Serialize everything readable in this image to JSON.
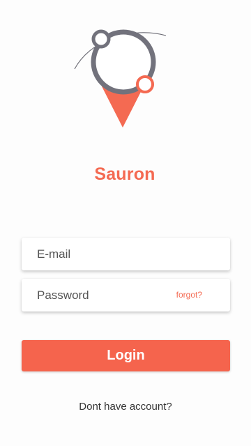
{
  "app": {
    "title": "Sauron",
    "logo": "location-pin-ring-logo"
  },
  "colors": {
    "accent": "#f46a52",
    "button": "#f5644d",
    "ring": "#72727c",
    "text": "#333333"
  },
  "form": {
    "email_placeholder": "E-mail",
    "email_value": "",
    "password_placeholder": "Password",
    "password_value": "",
    "forgot_label": "forgot?",
    "login_label": "Login"
  },
  "footer": {
    "signup_label": "Dont have account?"
  }
}
